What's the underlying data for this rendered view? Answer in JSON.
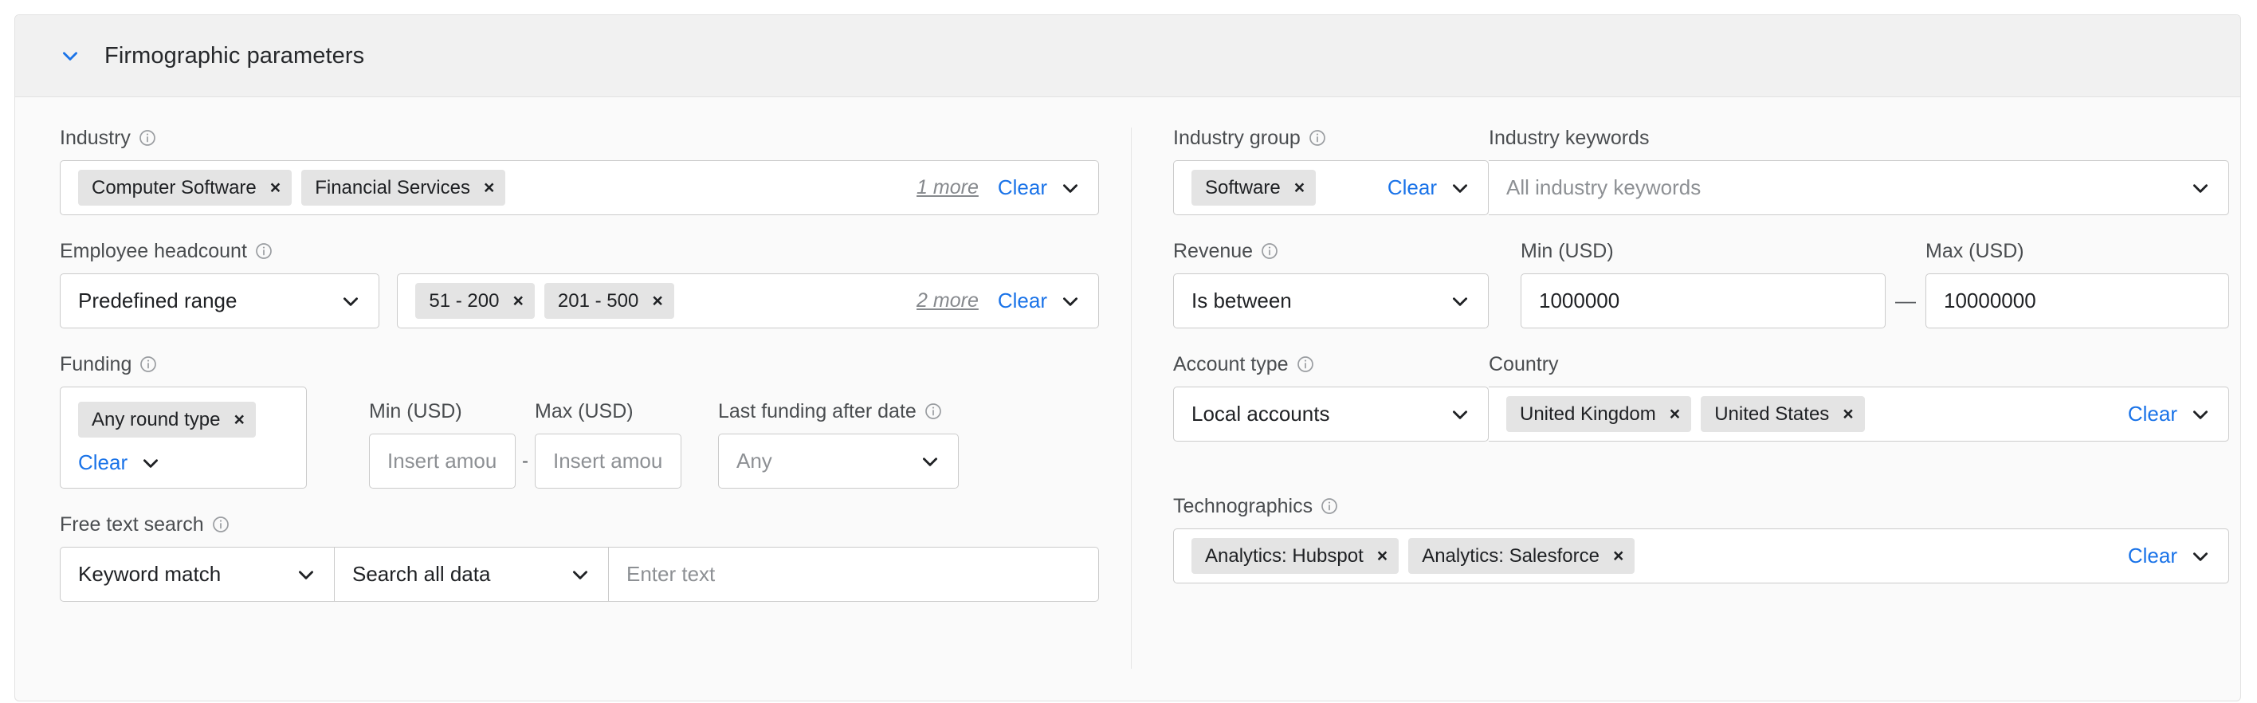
{
  "panel": {
    "title": "Firmographic parameters",
    "collapse_icon": "chevron-down-icon",
    "accent_color": "#1a73e8",
    "chip_bg": "#e4e4e4",
    "header_bg": "#f1f1f1"
  },
  "left": {
    "industry": {
      "label": "Industry",
      "info_icon": "info-icon",
      "chips": [
        "Computer Software",
        "Financial Services"
      ],
      "more_label": "1 more",
      "clear_label": "Clear",
      "caret_icon": "chevron-down-icon"
    },
    "employee_headcount": {
      "label": "Employee headcount",
      "info_icon": "info-icon",
      "mode_value": "Predefined range",
      "chips": [
        "51 - 200",
        "201 - 500"
      ],
      "more_label": "2 more",
      "clear_label": "Clear",
      "caret_icon": "chevron-down-icon"
    },
    "funding": {
      "label": "Funding",
      "info_icon": "info-icon",
      "chips": [
        "Any round type"
      ],
      "clear_label": "Clear",
      "caret_icon": "chevron-down-icon",
      "min_label": "Min (USD)",
      "min_placeholder": "Insert amount",
      "min_value": "",
      "dash": "-",
      "max_label": "Max (USD)",
      "max_placeholder": "Insert amount",
      "max_value": "",
      "last_funding_label": "Last funding after date",
      "last_funding_value": "Any"
    },
    "free_text_search": {
      "label": "Free text search",
      "info_icon": "info-icon",
      "match_mode": "Keyword match",
      "scope": "Search all data",
      "text_placeholder": "Enter text",
      "text_value": "",
      "caret_icon": "chevron-down-icon"
    }
  },
  "right": {
    "industry_group": {
      "label": "Industry group",
      "info_icon": "info-icon",
      "chips": [
        "Software"
      ],
      "clear_label": "Clear",
      "caret_icon": "chevron-down-icon"
    },
    "industry_keywords": {
      "label": "Industry keywords",
      "placeholder": "All industry keywords",
      "value": "",
      "caret_icon": "chevron-down-icon"
    },
    "revenue": {
      "label": "Revenue",
      "info_icon": "info-icon",
      "operator": "Is between",
      "min_label": "Min (USD)",
      "min_value": "1000000",
      "dash": "—",
      "max_label": "Max (USD)",
      "max_value": "10000000",
      "caret_icon": "chevron-down-icon"
    },
    "account_type": {
      "label": "Account type",
      "info_icon": "info-icon",
      "value": "Local accounts",
      "caret_icon": "chevron-down-icon"
    },
    "country": {
      "label": "Country",
      "chips": [
        "United Kingdom",
        "United States"
      ],
      "clear_label": "Clear",
      "caret_icon": "chevron-down-icon"
    },
    "technographics": {
      "label": "Technographics",
      "info_icon": "info-icon",
      "chips": [
        "Analytics: Hubspot",
        "Analytics: Salesforce"
      ],
      "clear_label": "Clear",
      "caret_icon": "chevron-down-icon"
    }
  },
  "icons": {
    "chip_remove": "×"
  }
}
